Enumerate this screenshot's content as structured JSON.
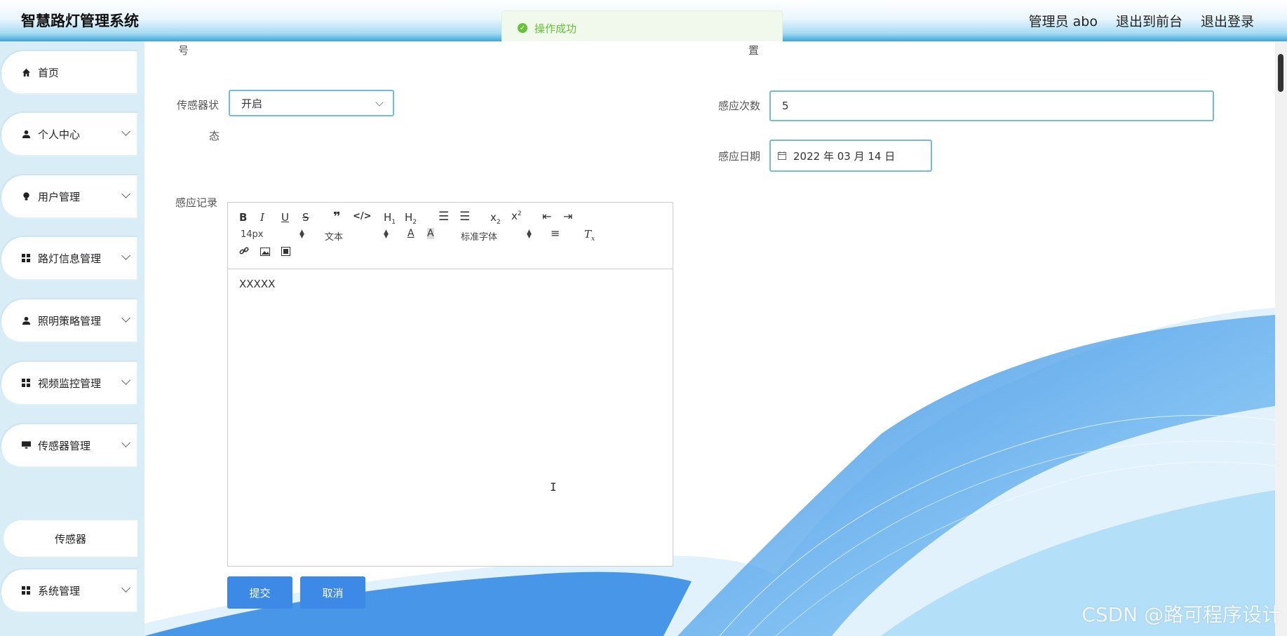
{
  "app": {
    "title": "智慧路灯管理系统"
  },
  "header": {
    "user": "管理员 abo",
    "to_front": "退出到前台",
    "logout": "退出登录"
  },
  "toast": {
    "message": "操作成功",
    "color": "#67c23a"
  },
  "sidebar": {
    "items": [
      {
        "label": "首页",
        "icon": "home-icon"
      },
      {
        "label": "个人中心",
        "icon": "user-icon"
      },
      {
        "label": "用户管理",
        "icon": "bulb-icon"
      },
      {
        "label": "路灯信息管理",
        "icon": "grid-icon"
      },
      {
        "label": "照明策略管理",
        "icon": "user-icon"
      },
      {
        "label": "视频监控管理",
        "icon": "grid-icon"
      },
      {
        "label": "传感器管理",
        "icon": "monitor-icon"
      },
      {
        "label": "系统管理",
        "icon": "grid-icon"
      }
    ],
    "sub_item": "传感器"
  },
  "form": {
    "label_top_left": "号",
    "label_top_right": "置",
    "status_label_1": "传感器状",
    "status_label_2": "态",
    "status_value": "开启",
    "count_label": "感应次数",
    "count_value": "5",
    "date_label": "感应日期",
    "date_value": "2022 年 03 月 14 日",
    "record_label": "感应记录",
    "record_content": "XXXXX"
  },
  "editor": {
    "font_size": "14px",
    "format": "文本",
    "font_family": "标准字体"
  },
  "buttons": {
    "submit": "提交",
    "cancel": "取消"
  },
  "watermark": "CSDN @路可程序设计",
  "colors": {
    "accent": "#3d8ae6",
    "input_border": "#74bcd6",
    "sidebar_bg": "#d8edf6"
  }
}
